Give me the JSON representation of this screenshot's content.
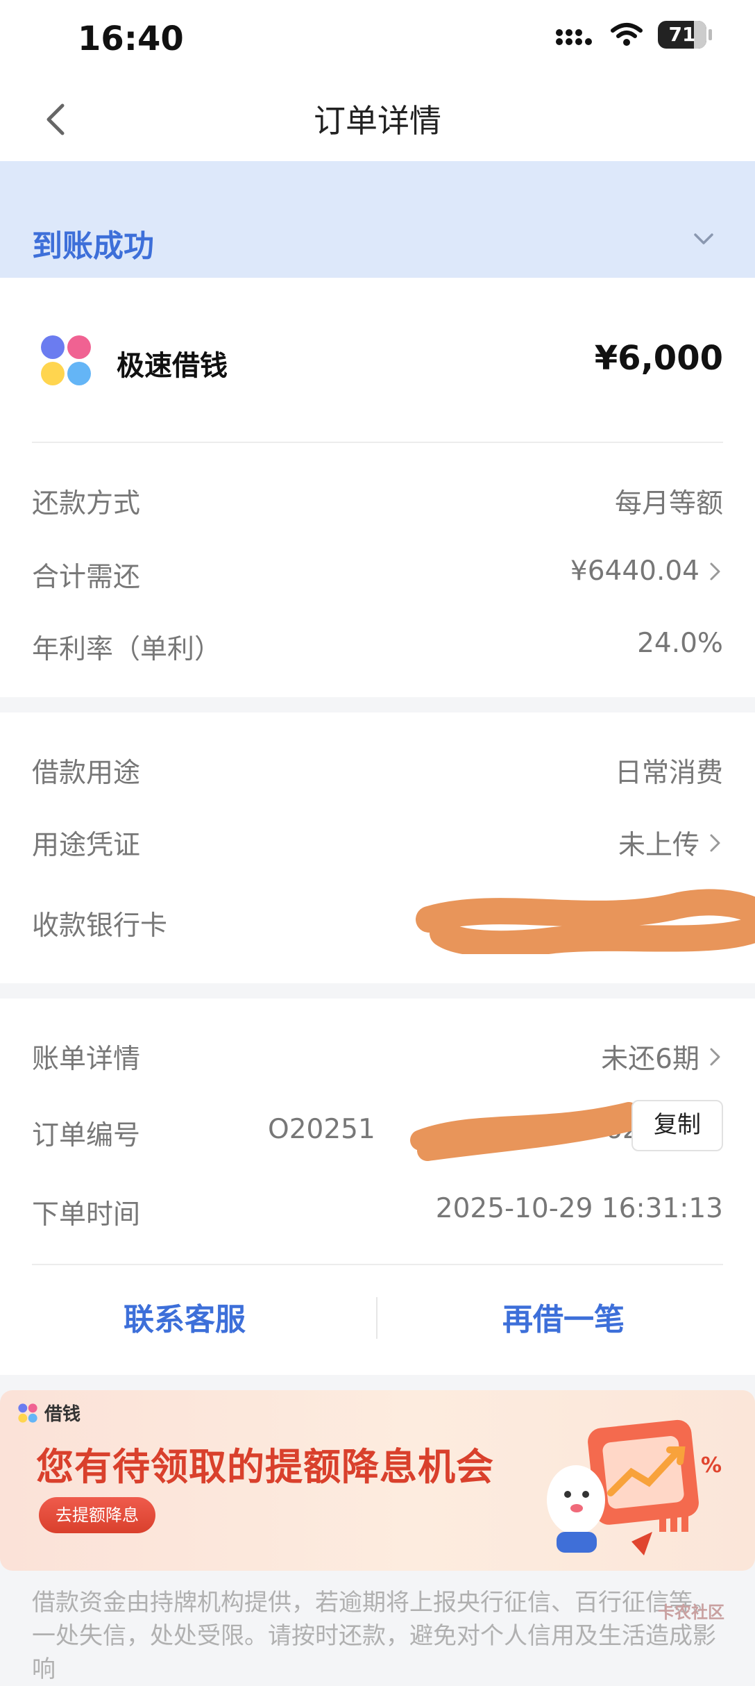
{
  "status_bar": {
    "time": "16:40",
    "battery": "71"
  },
  "nav": {
    "title": "订单详情"
  },
  "status_banner": {
    "label": "到账成功"
  },
  "product": {
    "name": "极速借钱",
    "amount": "¥6,000"
  },
  "repayment": [
    {
      "key": "还款方式",
      "value": "每月等额",
      "arrow": false
    },
    {
      "key": "合计需还",
      "value": "¥6440.04",
      "arrow": true
    },
    {
      "key": "年利率（单利）",
      "value": "24.0%",
      "arrow": false
    }
  ],
  "loan_info": [
    {
      "key": "借款用途",
      "value": "日常消费",
      "arrow": false
    },
    {
      "key": "用途凭证",
      "value": "未上传",
      "arrow": true
    },
    {
      "key": "收款银行卡",
      "value": "",
      "arrow": false
    }
  ],
  "order_info": {
    "bill_key": "账单详情",
    "bill_value": "未还6期",
    "order_no_key": "订单编号",
    "order_no_value": "O20251",
    "order_no_tail": "62",
    "copy_label": "复制",
    "time_key": "下单时间",
    "time_value": "2025-10-29 16:31:13"
  },
  "actions": {
    "contact": "联系客服",
    "borrow_again": "再借一笔"
  },
  "promo": {
    "brand": "借钱",
    "headline": "您有待领取的提额降息机会",
    "cta": "去提额降息"
  },
  "disclaimer": "借款资金由持牌机构提供，若逾期将上报央行征信、百行征信等。一处失信，处处受限。请按时还款，避免对个人信用及生活造成影响",
  "watermark": "卡农社区",
  "colors": {
    "accent": "#3d6fd9",
    "banner_bg": "#dde8fa",
    "promo_red": "#d9402c"
  }
}
